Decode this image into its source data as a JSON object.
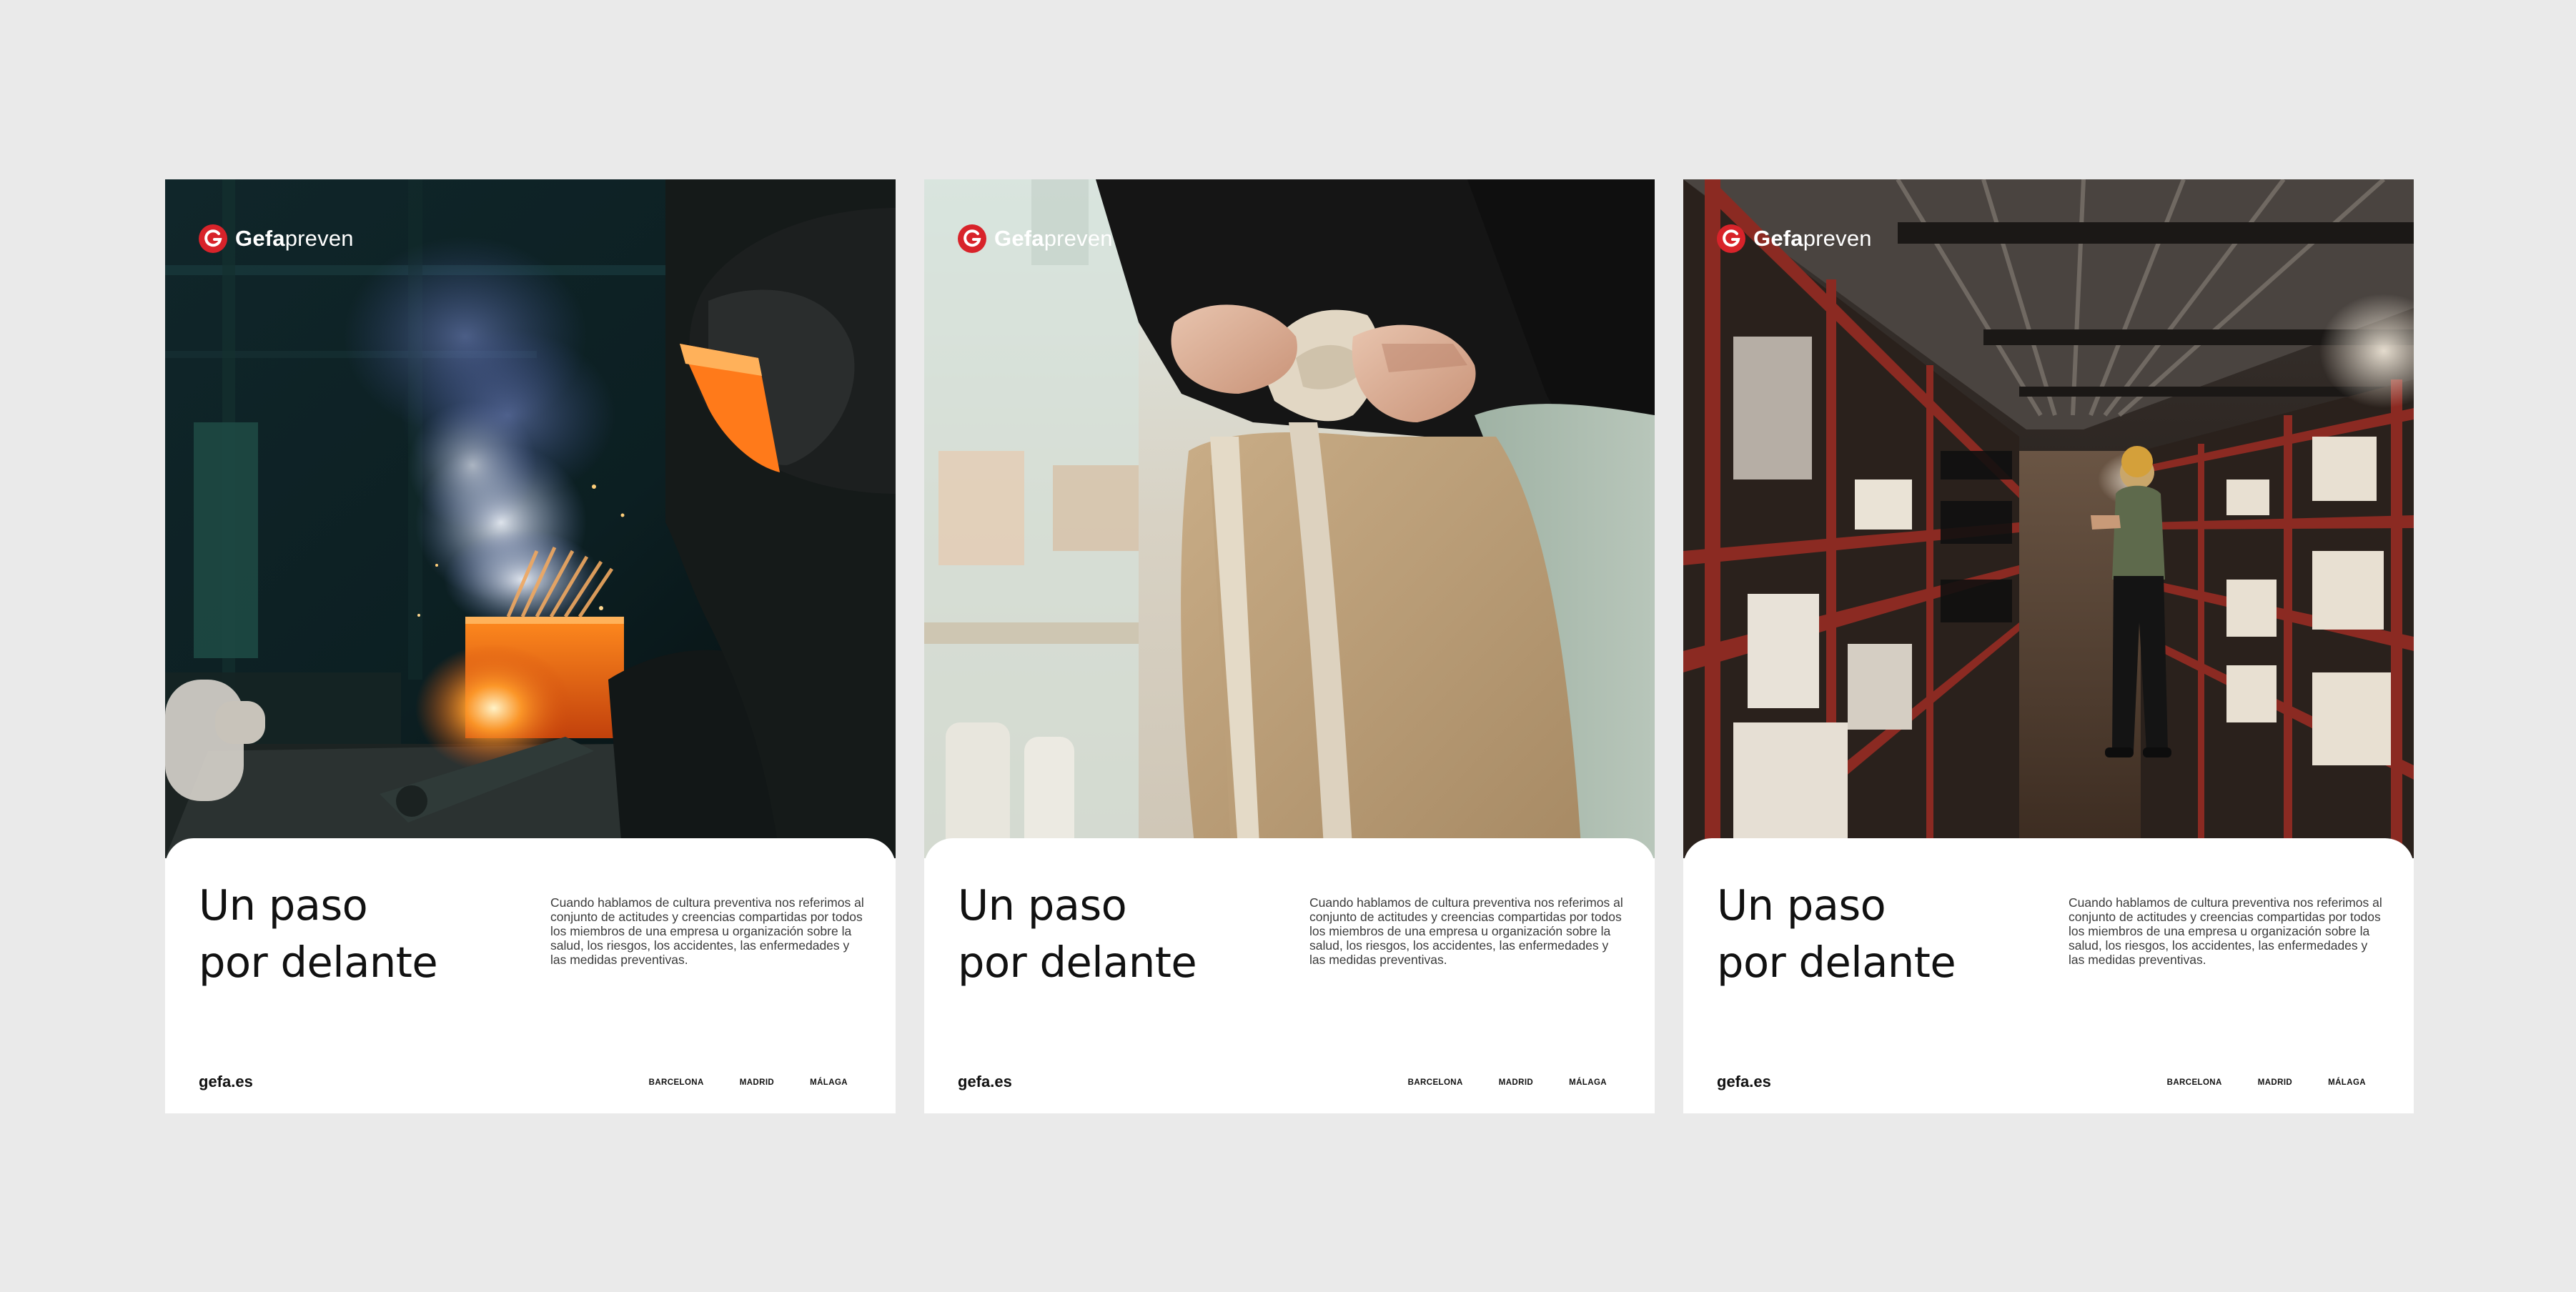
{
  "colors": {
    "background": "#eaeaea",
    "card": "#ffffff",
    "brand_red": "#d8232a",
    "text": "#111111"
  },
  "posters": [
    {
      "brand": {
        "bold": "Gefa",
        "light": "preven",
        "icon": "gefapreven-logo-icon"
      },
      "photo": "welder-with-sparks-and-smoke",
      "headline": {
        "line1": "Un paso",
        "line2": "por delante"
      },
      "description": "Cuando hablamos de cultura preventiva nos referimos al conjunto de actitudes y creencias compartidas por todos los miembros de una empresa u organización sobre la salud, los riesgos, los accidentes, las enfermedades y las medidas preventivas.",
      "site": "gefa.es",
      "cities": [
        "BARCELONA",
        "MADRID",
        "MÁLAGA"
      ]
    },
    {
      "brand": {
        "bold": "Gefa",
        "light": "preven",
        "icon": "gefapreven-logo-icon"
      },
      "photo": "worker-tying-apron",
      "headline": {
        "line1": "Un paso",
        "line2": "por delante"
      },
      "description": "Cuando hablamos de cultura preventiva nos referimos al conjunto de actitudes y creencias compartidas por todos los miembros de una empresa u organización sobre la salud, los riesgos, los accidentes, las enfermedades y las medidas preventivas.",
      "site": "gefa.es",
      "cities": [
        "BARCELONA",
        "MADRID",
        "MÁLAGA"
      ]
    },
    {
      "brand": {
        "bold": "Gefa",
        "light": "preven",
        "icon": "gefapreven-logo-icon"
      },
      "photo": "warehouse-worker-between-shelves",
      "headline": {
        "line1": "Un paso",
        "line2": "por delante"
      },
      "description": "Cuando hablamos de cultura preventiva nos referimos al conjunto de actitudes y creencias compartidas por todos los miembros de una empresa u organización sobre la salud, los riesgos, los accidentes, las enfermedades y las medidas preventivas.",
      "site": "gefa.es",
      "cities": [
        "BARCELONA",
        "MADRID",
        "MÁLAGA"
      ]
    }
  ]
}
